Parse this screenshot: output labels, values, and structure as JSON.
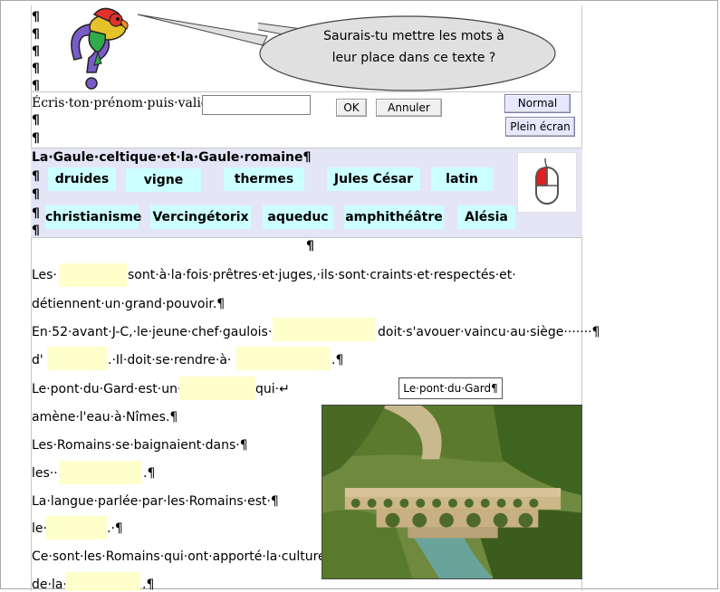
{
  "prompt": {
    "bubble_line1": "Saurais-tu mettre les mots  à",
    "bubble_line2": "leur place dans ce texte ?"
  },
  "name_form": {
    "label": "Écris·ton·prénom·puis·valide·",
    "input_value": "",
    "ok_label": "OK",
    "cancel_label": "Annuler"
  },
  "view_buttons": {
    "normal_label": "Normal",
    "fullscreen_label": "Plein écran"
  },
  "pilcrow": "¶",
  "bank": {
    "title": "La·Gaule·celtique·et·la·Gaule·romaine¶",
    "row1": [
      "druides",
      "vigne",
      "thermes",
      "Jules César",
      "latin"
    ],
    "row2": [
      "christianisme",
      "Vercingétorix",
      "aqueduc",
      "amphithéâtre",
      "Alésia"
    ]
  },
  "text": {
    "l1a": "Les·",
    "l1b": "sont·à·la·fois·prêtres·et·juges,·ils·sont·craints·et·respectés·et·",
    "l2": "détiennent·un·grand·pouvoir.¶",
    "l3a": "En·52·avant·J-C,·le·jeune·chef·gaulois·",
    "l3b": "doit·s'avouer·vaincu·au·siège·······¶",
    "l4a": "d'",
    "l4b": ".·Il·doit·se·rendre·à·",
    "l4c": ".¶",
    "l5a": "Le·pont·du·Gard·est·un·",
    "l5b": "qui·↵",
    "l6": "amène·l'eau·à·Nîmes.¶",
    "l7": "Les·Romains·se·baignaient·dans·¶",
    "l8a": "les··",
    "l8b": ".¶",
    "l9": "La·langue·parlée·par·les·Romains·est·¶",
    "l10a": "le·",
    "l10b": ".·¶",
    "l11": "Ce·sont·les·Romains·qui·ont·apporté·la·culture·",
    "l12a": "de·la·",
    "l12b": ".¶"
  },
  "photo_caption": "Le·pont·du·Gard¶",
  "icons": {
    "parrot": "parrot-question-icon",
    "mouse": "mouse-icon"
  }
}
